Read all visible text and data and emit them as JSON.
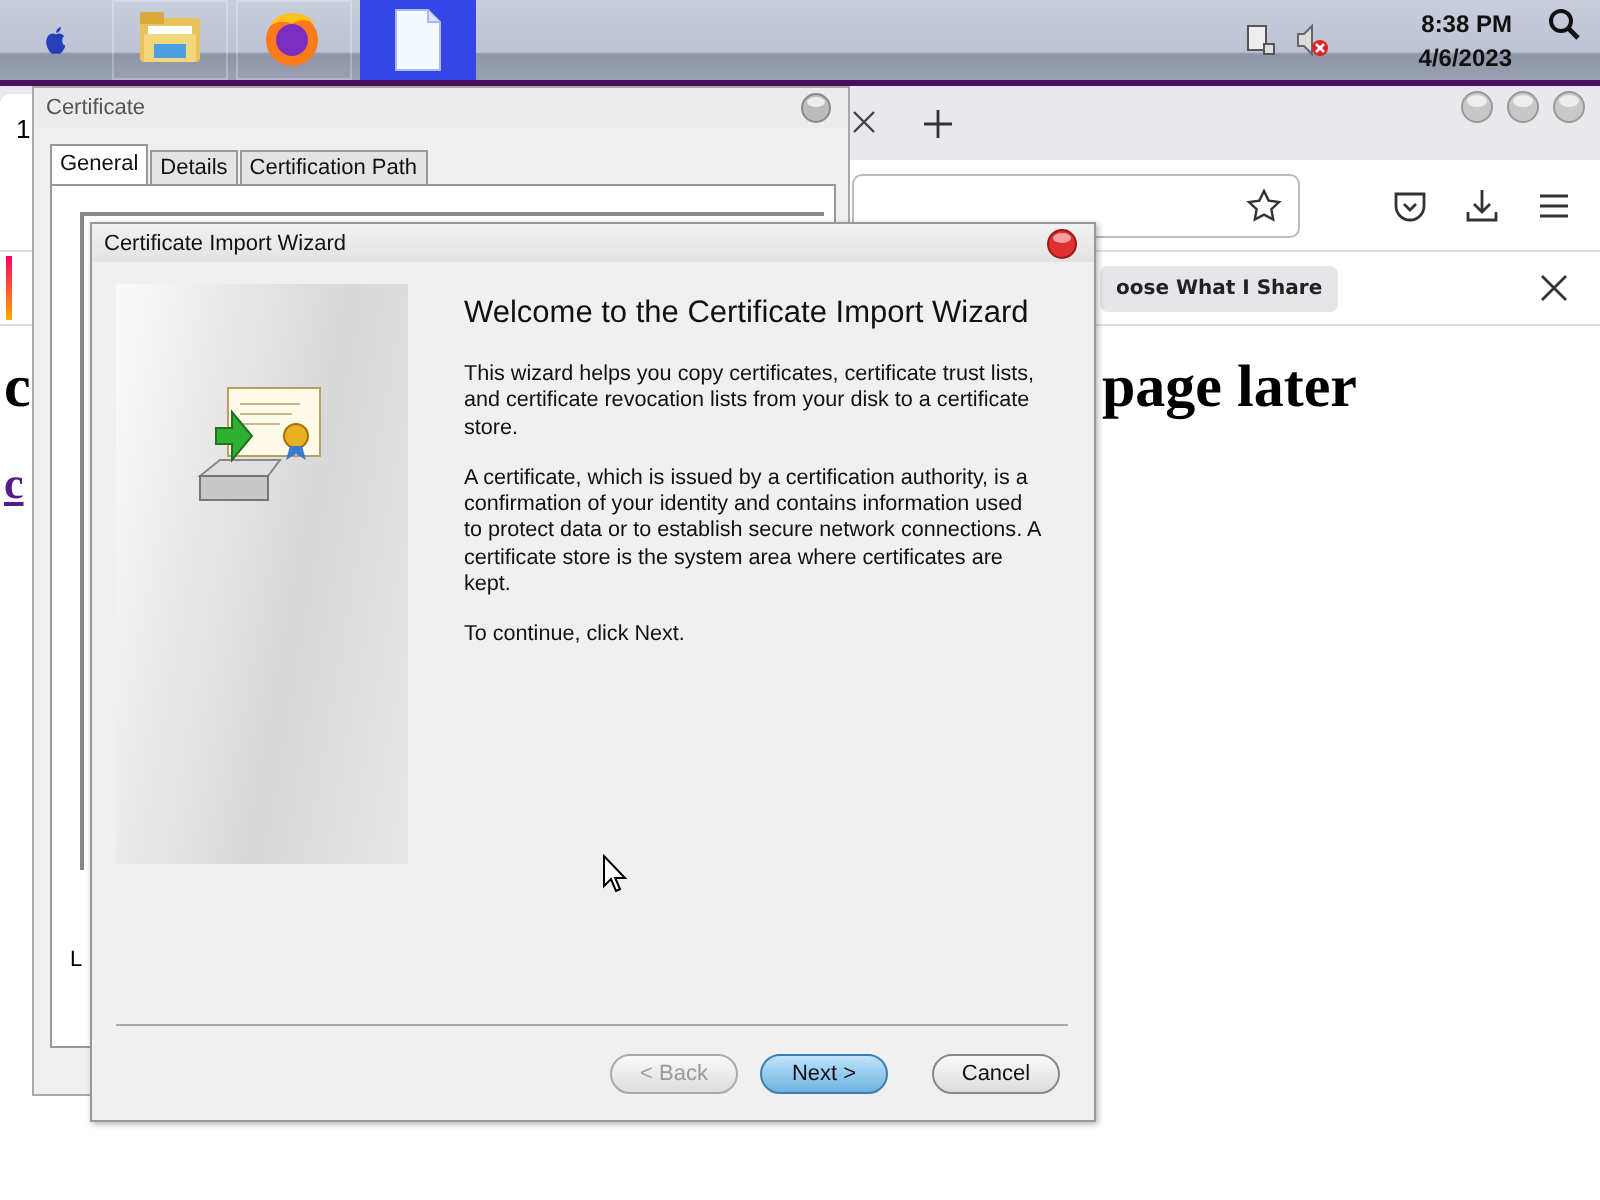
{
  "taskbar": {
    "apps": [
      {
        "kind": "folder",
        "selected": false
      },
      {
        "kind": "browser",
        "selected": false
      },
      {
        "kind": "document",
        "selected": true
      }
    ],
    "tray": {
      "sound_muted": true
    },
    "clock": {
      "time": "8:38 PM",
      "date": "4/6/2023"
    }
  },
  "browser": {
    "tab": {
      "label": "1"
    },
    "notification": {
      "button": "oose What I Share"
    },
    "page": {
      "heading_parts": [
        "c",
        "page later"
      ],
      "link": "c"
    }
  },
  "certificate": {
    "title": "Certificate",
    "tabs": [
      {
        "label": "General",
        "selected": true
      },
      {
        "label": "Details",
        "selected": false
      },
      {
        "label": "Certification Path",
        "selected": false
      }
    ],
    "footer_text": "L"
  },
  "wizard": {
    "title": "Certificate Import Wizard",
    "heading": "Welcome to the Certificate Import Wizard",
    "paragraphs": [
      "This wizard helps you copy certificates, certificate trust lists, and certificate revocation lists from your disk to a certificate store.",
      "A certificate, which is issued by a certification authority, is a confirmation of your identity and contains information used to protect data or to establish secure network connections. A certificate store is the system area where certificates are kept.",
      "To continue, click Next."
    ],
    "buttons": [
      {
        "label": "< Back",
        "disabled": true,
        "default": false
      },
      {
        "label": "Next >",
        "disabled": false,
        "default": true
      },
      {
        "label": "Cancel",
        "disabled": false,
        "default": false
      }
    ]
  }
}
